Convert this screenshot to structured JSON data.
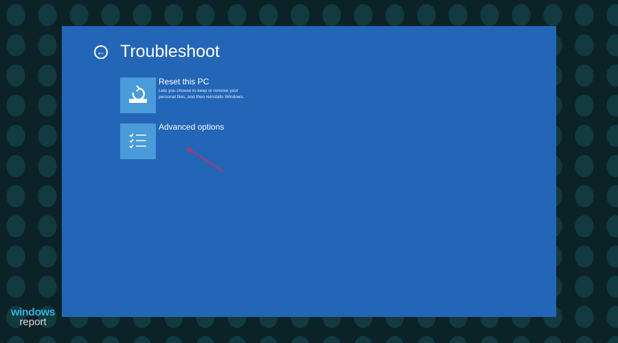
{
  "page": {
    "title": "Troubleshoot",
    "back_icon": "back-arrow-icon"
  },
  "options": [
    {
      "title": "Reset this PC",
      "description": "Lets you choose to keep or remove your personal files, and then reinstalls Windows.",
      "icon": "reset-pc-icon"
    },
    {
      "title": "Advanced options",
      "icon": "checklist-icon"
    }
  ],
  "annotation": {
    "color": "#c0306a"
  },
  "logo": {
    "line1": "windows",
    "line2": "report"
  }
}
